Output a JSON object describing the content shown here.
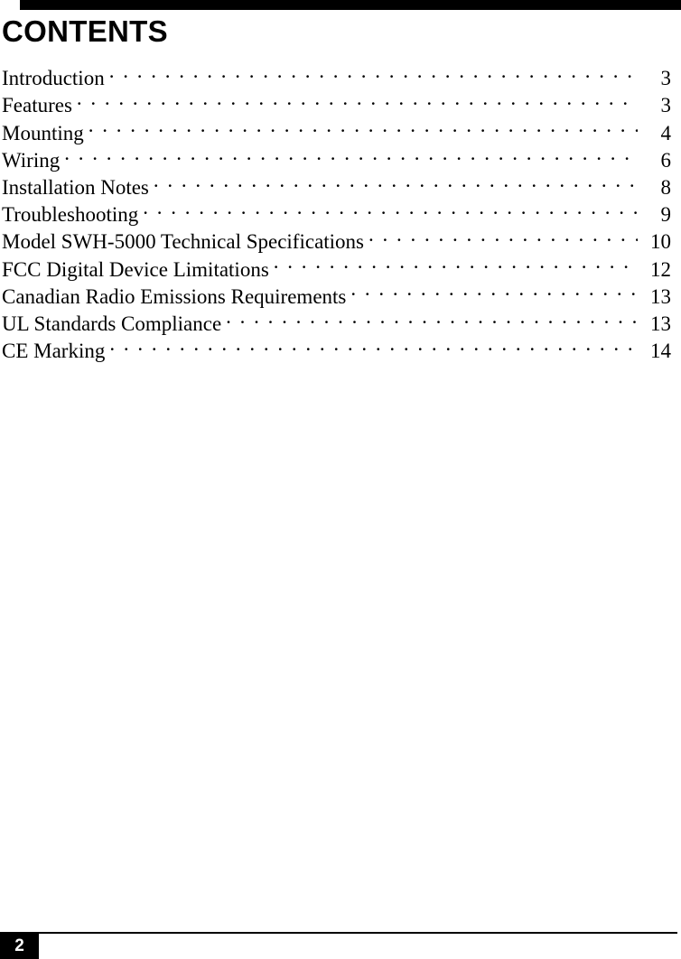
{
  "document": {
    "page_title": "CONTENTS",
    "footer_page_number": "2",
    "accent_color": "#000000",
    "background_color": "#ffffff"
  },
  "toc": {
    "leader_char": ".",
    "entries": [
      {
        "label": "Introduction",
        "page": "3"
      },
      {
        "label": "Features",
        "page": "3"
      },
      {
        "label": "Mounting",
        "page": "4"
      },
      {
        "label": "Wiring",
        "page": "6"
      },
      {
        "label": "Installation Notes",
        "page": "8"
      },
      {
        "label": "Troubleshooting",
        "page": "9"
      },
      {
        "label": "Model SWH-5000 Technical Specifications",
        "page": "10"
      },
      {
        "label": "FCC Digital Device Limitations",
        "page": "12"
      },
      {
        "label": "Canadian Radio Emissions Requirements",
        "page": "13"
      },
      {
        "label": "UL Standards Compliance",
        "page": "13"
      },
      {
        "label": "CE Marking",
        "page": "14"
      }
    ]
  }
}
